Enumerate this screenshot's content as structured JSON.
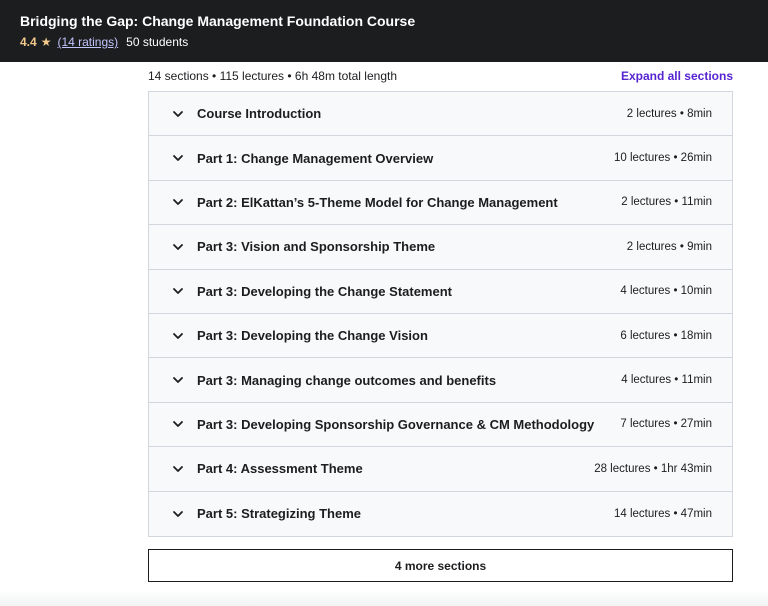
{
  "header": {
    "title": "Bridging the Gap: Change Management Foundation Course",
    "rating": "4.4",
    "star_icon": "★",
    "ratings_link": "(14 ratings)",
    "students": "50 students"
  },
  "summary": {
    "text": "14 sections • 115 lectures • 6h 48m total length",
    "expand_label": "Expand all sections"
  },
  "sections": [
    {
      "title": "Course Introduction",
      "meta": "2 lectures • 8min"
    },
    {
      "title": "Part 1: Change Management Overview",
      "meta": "10 lectures • 26min"
    },
    {
      "title": "Part 2: ElKattan’s 5-Theme Model for Change Management",
      "meta": "2 lectures • 11min"
    },
    {
      "title": "Part 3: Vision and Sponsorship Theme",
      "meta": "2 lectures • 9min"
    },
    {
      "title": "Part 3: Developing the Change Statement",
      "meta": "4 lectures • 10min"
    },
    {
      "title": "Part 3: Developing the Change Vision",
      "meta": "6 lectures • 18min"
    },
    {
      "title": "Part 3: Managing change outcomes and benefits",
      "meta": "4 lectures • 11min"
    },
    {
      "title": "Part 3: Developing Sponsorship Governance & CM Methodology",
      "meta": "7 lectures • 27min"
    },
    {
      "title": "Part 4: Assessment Theme",
      "meta": "28 lectures • 1hr 43min"
    },
    {
      "title": "Part 5: Strategizing Theme",
      "meta": "14 lectures • 47min"
    }
  ],
  "more_sections_label": "4 more sections",
  "colors": {
    "header_bg": "#1c1d1f",
    "star": "#f3ca8c",
    "link_purple": "#5624d0",
    "row_bg": "#f7f9fa",
    "border": "#d1d7dc"
  }
}
